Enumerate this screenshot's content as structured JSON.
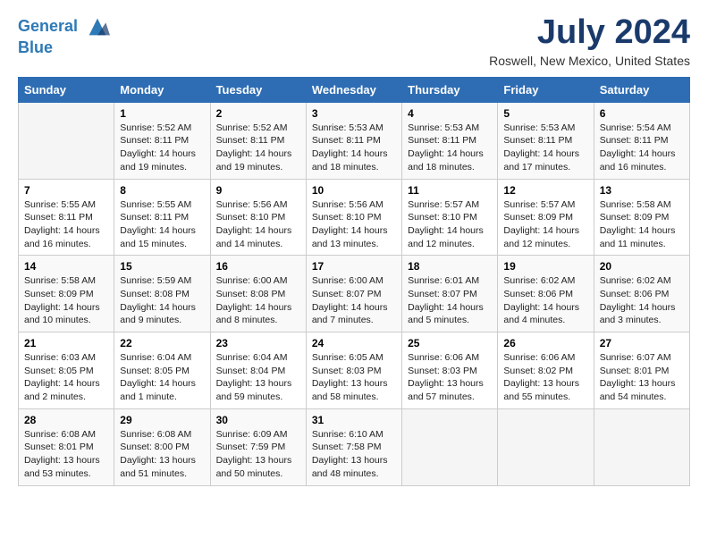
{
  "header": {
    "logo_line1": "General",
    "logo_line2": "Blue",
    "month_title": "July 2024",
    "location": "Roswell, New Mexico, United States"
  },
  "days_of_week": [
    "Sunday",
    "Monday",
    "Tuesday",
    "Wednesday",
    "Thursday",
    "Friday",
    "Saturday"
  ],
  "weeks": [
    [
      {
        "day": "",
        "info": ""
      },
      {
        "day": "1",
        "info": "Sunrise: 5:52 AM\nSunset: 8:11 PM\nDaylight: 14 hours\nand 19 minutes."
      },
      {
        "day": "2",
        "info": "Sunrise: 5:52 AM\nSunset: 8:11 PM\nDaylight: 14 hours\nand 19 minutes."
      },
      {
        "day": "3",
        "info": "Sunrise: 5:53 AM\nSunset: 8:11 PM\nDaylight: 14 hours\nand 18 minutes."
      },
      {
        "day": "4",
        "info": "Sunrise: 5:53 AM\nSunset: 8:11 PM\nDaylight: 14 hours\nand 18 minutes."
      },
      {
        "day": "5",
        "info": "Sunrise: 5:53 AM\nSunset: 8:11 PM\nDaylight: 14 hours\nand 17 minutes."
      },
      {
        "day": "6",
        "info": "Sunrise: 5:54 AM\nSunset: 8:11 PM\nDaylight: 14 hours\nand 16 minutes."
      }
    ],
    [
      {
        "day": "7",
        "info": "Sunrise: 5:55 AM\nSunset: 8:11 PM\nDaylight: 14 hours\nand 16 minutes."
      },
      {
        "day": "8",
        "info": "Sunrise: 5:55 AM\nSunset: 8:11 PM\nDaylight: 14 hours\nand 15 minutes."
      },
      {
        "day": "9",
        "info": "Sunrise: 5:56 AM\nSunset: 8:10 PM\nDaylight: 14 hours\nand 14 minutes."
      },
      {
        "day": "10",
        "info": "Sunrise: 5:56 AM\nSunset: 8:10 PM\nDaylight: 14 hours\nand 13 minutes."
      },
      {
        "day": "11",
        "info": "Sunrise: 5:57 AM\nSunset: 8:10 PM\nDaylight: 14 hours\nand 12 minutes."
      },
      {
        "day": "12",
        "info": "Sunrise: 5:57 AM\nSunset: 8:09 PM\nDaylight: 14 hours\nand 12 minutes."
      },
      {
        "day": "13",
        "info": "Sunrise: 5:58 AM\nSunset: 8:09 PM\nDaylight: 14 hours\nand 11 minutes."
      }
    ],
    [
      {
        "day": "14",
        "info": "Sunrise: 5:58 AM\nSunset: 8:09 PM\nDaylight: 14 hours\nand 10 minutes."
      },
      {
        "day": "15",
        "info": "Sunrise: 5:59 AM\nSunset: 8:08 PM\nDaylight: 14 hours\nand 9 minutes."
      },
      {
        "day": "16",
        "info": "Sunrise: 6:00 AM\nSunset: 8:08 PM\nDaylight: 14 hours\nand 8 minutes."
      },
      {
        "day": "17",
        "info": "Sunrise: 6:00 AM\nSunset: 8:07 PM\nDaylight: 14 hours\nand 7 minutes."
      },
      {
        "day": "18",
        "info": "Sunrise: 6:01 AM\nSunset: 8:07 PM\nDaylight: 14 hours\nand 5 minutes."
      },
      {
        "day": "19",
        "info": "Sunrise: 6:02 AM\nSunset: 8:06 PM\nDaylight: 14 hours\nand 4 minutes."
      },
      {
        "day": "20",
        "info": "Sunrise: 6:02 AM\nSunset: 8:06 PM\nDaylight: 14 hours\nand 3 minutes."
      }
    ],
    [
      {
        "day": "21",
        "info": "Sunrise: 6:03 AM\nSunset: 8:05 PM\nDaylight: 14 hours\nand 2 minutes."
      },
      {
        "day": "22",
        "info": "Sunrise: 6:04 AM\nSunset: 8:05 PM\nDaylight: 14 hours\nand 1 minute."
      },
      {
        "day": "23",
        "info": "Sunrise: 6:04 AM\nSunset: 8:04 PM\nDaylight: 13 hours\nand 59 minutes."
      },
      {
        "day": "24",
        "info": "Sunrise: 6:05 AM\nSunset: 8:03 PM\nDaylight: 13 hours\nand 58 minutes."
      },
      {
        "day": "25",
        "info": "Sunrise: 6:06 AM\nSunset: 8:03 PM\nDaylight: 13 hours\nand 57 minutes."
      },
      {
        "day": "26",
        "info": "Sunrise: 6:06 AM\nSunset: 8:02 PM\nDaylight: 13 hours\nand 55 minutes."
      },
      {
        "day": "27",
        "info": "Sunrise: 6:07 AM\nSunset: 8:01 PM\nDaylight: 13 hours\nand 54 minutes."
      }
    ],
    [
      {
        "day": "28",
        "info": "Sunrise: 6:08 AM\nSunset: 8:01 PM\nDaylight: 13 hours\nand 53 minutes."
      },
      {
        "day": "29",
        "info": "Sunrise: 6:08 AM\nSunset: 8:00 PM\nDaylight: 13 hours\nand 51 minutes."
      },
      {
        "day": "30",
        "info": "Sunrise: 6:09 AM\nSunset: 7:59 PM\nDaylight: 13 hours\nand 50 minutes."
      },
      {
        "day": "31",
        "info": "Sunrise: 6:10 AM\nSunset: 7:58 PM\nDaylight: 13 hours\nand 48 minutes."
      },
      {
        "day": "",
        "info": ""
      },
      {
        "day": "",
        "info": ""
      },
      {
        "day": "",
        "info": ""
      }
    ]
  ]
}
